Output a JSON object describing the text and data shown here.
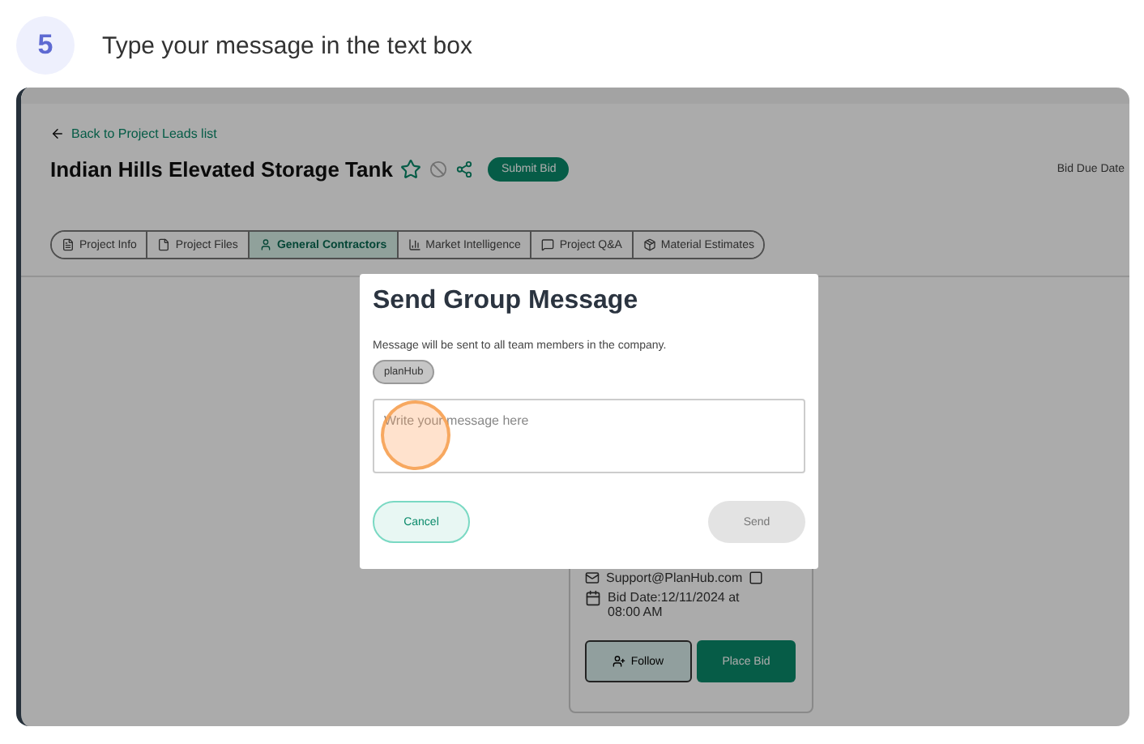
{
  "step": {
    "number": "5",
    "text": "Type your message in the text box"
  },
  "page": {
    "back_link": "Back to Project Leads list",
    "title": "Indian Hills Elevated Storage Tank",
    "starred": false,
    "submit_button": "Submit Bid",
    "bid_due_label": "Bid Due Date",
    "tabs": [
      {
        "label": "Project Info",
        "kind": "info",
        "selected": false
      },
      {
        "label": "Project Files",
        "kind": "file",
        "selected": false
      },
      {
        "label": "General Contractors",
        "kind": "person",
        "selected": true
      },
      {
        "label": "Market Intelligence",
        "kind": "chart",
        "selected": false
      },
      {
        "label": "Project Q&A",
        "kind": "chat",
        "selected": false
      },
      {
        "label": "Material Estimates",
        "kind": "box",
        "selected": false
      }
    ],
    "card": {
      "email": "Support@PlanHub.com",
      "bid_date": "Bid Date:12/11/2024 at 08:00 AM",
      "follow_button": "Follow",
      "place_bid_button": "Place Bid"
    }
  },
  "dialog": {
    "title": "Send Group Message",
    "description": "Message will be sent to all team members in the company.",
    "chip": "planHub",
    "message_placeholder": "Write your message here",
    "cancel_button": "Cancel",
    "send_button": "Send",
    "send_disabled": true
  }
}
